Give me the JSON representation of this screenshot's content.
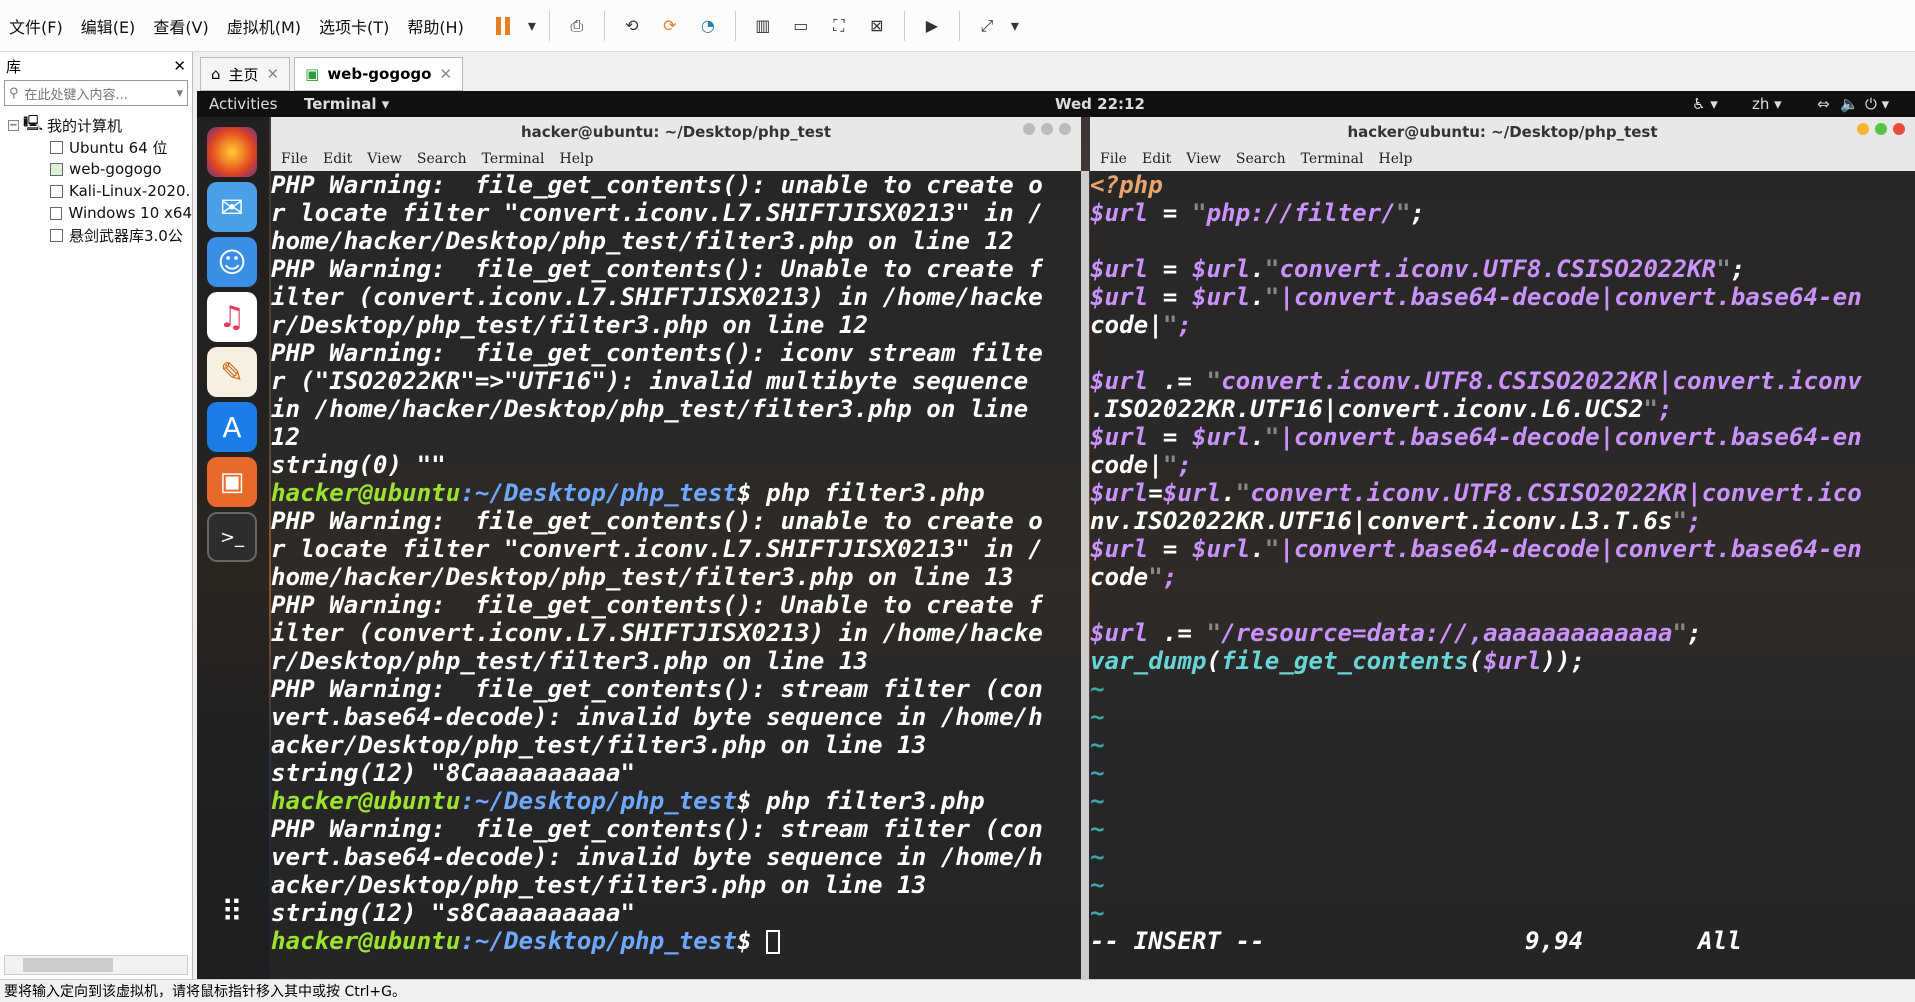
{
  "menu": [
    "文件(F)",
    "编辑(E)",
    "查看(V)",
    "虚拟机(M)",
    "选项卡(T)",
    "帮助(H)"
  ],
  "library": {
    "title": "库",
    "search_placeholder": "在此处键入内容...",
    "root": "我的计算机",
    "vms": [
      "Ubuntu 64 位",
      "web-gogogo",
      "Kali-Linux-2020.",
      "Windows 10 x64",
      "悬剑武器库3.0公"
    ]
  },
  "tabs": {
    "home": "主页",
    "vm": "web-gogogo"
  },
  "gnome": {
    "activities": "Activities",
    "app": "Terminal ▾",
    "clock": "Wed 22:12",
    "lang": "zh ▾"
  },
  "terminal_left": {
    "title": "hacker@ubuntu: ~/Desktop/php_test",
    "menu": [
      "File",
      "Edit",
      "View",
      "Search",
      "Terminal",
      "Help"
    ],
    "lines": [
      [
        "PHP Warning:  file_get_contents(): unable to create o"
      ],
      [
        "r locate filter \"convert.iconv.L7.SHIFTJISX0213\" in /"
      ],
      [
        "home/hacker/Desktop/php_test/filter3.php on line 12"
      ],
      [
        "PHP Warning:  file_get_contents(): Unable to create f"
      ],
      [
        "ilter (convert.iconv.L7.SHIFTJISX0213) in /home/hacke"
      ],
      [
        "r/Desktop/php_test/filter3.php on line 12"
      ],
      [
        "PHP Warning:  file_get_contents(): iconv stream filte"
      ],
      [
        "r (\"ISO2022KR\"=>\"UTF16\"): invalid multibyte sequence "
      ],
      [
        "in /home/hacker/Desktop/php_test/filter3.php on line"
      ],
      [
        "12"
      ],
      [
        "string(0) \"\""
      ],
      [
        "P",
        "php filter3.php"
      ],
      [
        "PHP Warning:  file_get_contents(): unable to create o"
      ],
      [
        "r locate filter \"convert.iconv.L7.SHIFTJISX0213\" in /"
      ],
      [
        "home/hacker/Desktop/php_test/filter3.php on line 13"
      ],
      [
        "PHP Warning:  file_get_contents(): Unable to create f"
      ],
      [
        "ilter (convert.iconv.L7.SHIFTJISX0213) in /home/hacke"
      ],
      [
        "r/Desktop/php_test/filter3.php on line 13"
      ],
      [
        "PHP Warning:  file_get_contents(): stream filter (con"
      ],
      [
        "vert.base64-decode): invalid byte sequence in /home/h"
      ],
      [
        "acker/Desktop/php_test/filter3.php on line 13"
      ],
      [
        "string(12) \"8Caaaaaaaaaa\""
      ],
      [
        "P",
        "php filter3.php"
      ],
      [
        "PHP Warning:  file_get_contents(): stream filter (con"
      ],
      [
        "vert.base64-decode): invalid byte sequence in /home/h"
      ],
      [
        "acker/Desktop/php_test/filter3.php on line 13"
      ],
      [
        "string(12) \"s8Caaaaaaaaa\""
      ],
      [
        "P",
        ""
      ]
    ],
    "prompt_user": "hacker@ubuntu",
    "prompt_path": ":~/Desktop/php_test",
    "prompt_dollar": "$ "
  },
  "terminal_right": {
    "title": "hacker@ubuntu: ~/Desktop/php_test",
    "menu": [
      "File",
      "Edit",
      "View",
      "Search",
      "Terminal",
      "Help"
    ],
    "code": [
      "<?php",
      "$url = \"php://filter/\";",
      "",
      "$url = $url.\"convert.iconv.UTF8.CSISO2022KR\";",
      "$url = $url.\"|convert.base64-decode|convert.base64-en",
      "code|\";",
      "",
      "$url .= \"convert.iconv.UTF8.CSISO2022KR|convert.iconv",
      ".ISO2022KR.UTF16|convert.iconv.L6.UCS2\";",
      "$url = $url.\"|convert.base64-decode|convert.base64-en",
      "code|\";",
      "$url=$url.\"convert.iconv.UTF8.CSISO2022KR|convert.ico",
      "nv.ISO2022KR.UTF16|convert.iconv.L3.T.6s\";",
      "$url = $url.\"|convert.base64-decode|convert.base64-en",
      "code\";",
      "",
      "$url .= \"/resource=data://,aaaaaaaaaaaaa\";",
      "var_dump(file_get_contents($url));"
    ],
    "tildes": 9,
    "mode": "-- INSERT --",
    "pos": "9,94",
    "scroll": "All"
  },
  "status": "要将输入定向到该虚拟机，请将鼠标指针移入其中或按 Ctrl+G。"
}
